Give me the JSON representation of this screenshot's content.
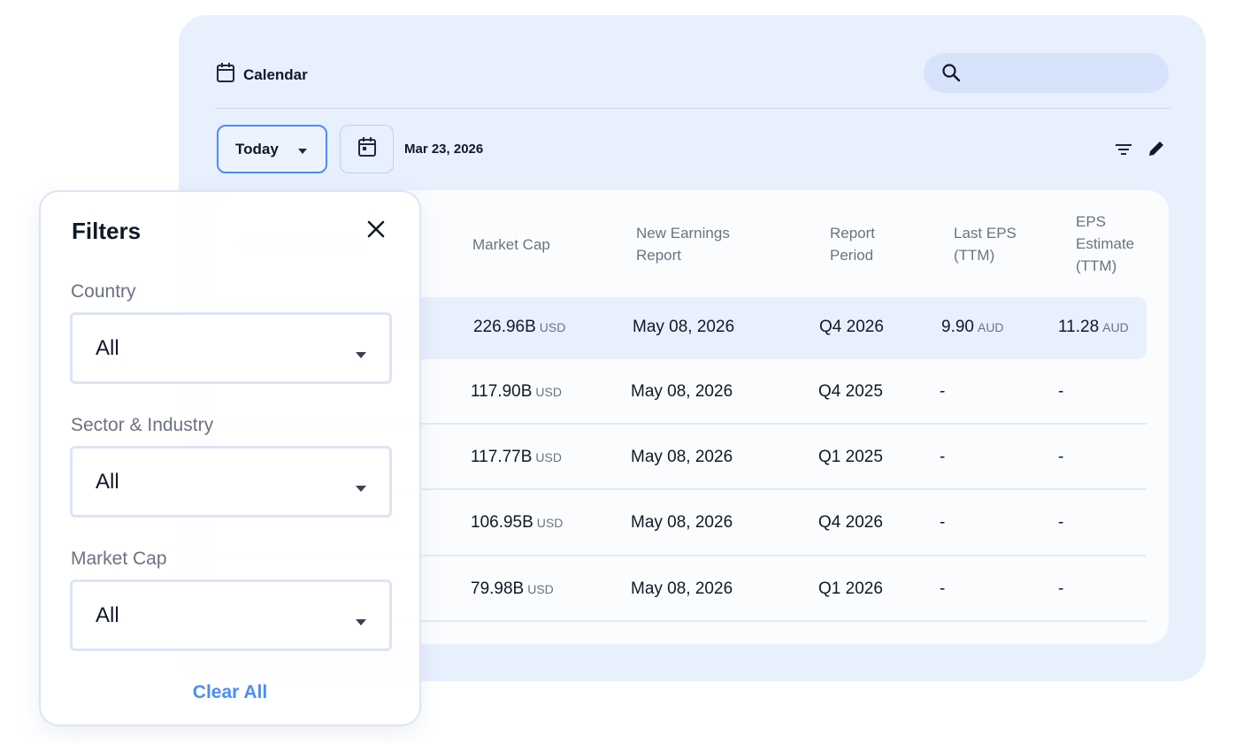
{
  "header": {
    "title": "Calendar",
    "search": {
      "placeholder": ""
    }
  },
  "toolbar": {
    "period_label": "Today",
    "date": "Mar 23, 2026"
  },
  "table": {
    "columns": {
      "market_cap": "Market Cap",
      "new_earnings_report": [
        "New Earnings",
        "Report"
      ],
      "report_period": [
        "Report",
        "Period"
      ],
      "last_eps": [
        "Last EPS",
        "(TTM)"
      ],
      "eps_estimate": [
        "EPS",
        "Estimate",
        "(TTM)"
      ]
    },
    "rows": [
      {
        "market_cap": "226.96B",
        "mc_unit": "USD",
        "report_date": "May 08, 2026",
        "period": "Q4 2026",
        "last_eps": "9.90",
        "last_eps_unit": "AUD",
        "eps_estimate": "11.28",
        "eps_estimate_unit": "AUD"
      },
      {
        "market_cap": "117.90B",
        "mc_unit": "USD",
        "report_date": "May 08, 2026",
        "period": "Q4 2025",
        "last_eps": "-",
        "last_eps_unit": "",
        "eps_estimate": "-",
        "eps_estimate_unit": ""
      },
      {
        "market_cap": "117.77B",
        "mc_unit": "USD",
        "report_date": "May 08, 2026",
        "period": "Q1 2025",
        "last_eps": "-",
        "last_eps_unit": "",
        "eps_estimate": "-",
        "eps_estimate_unit": ""
      },
      {
        "market_cap": "106.95B",
        "mc_unit": "USD",
        "report_date": "May 08, 2026",
        "period": "Q4 2026",
        "last_eps": "-",
        "last_eps_unit": "",
        "eps_estimate": "-",
        "eps_estimate_unit": ""
      },
      {
        "market_cap": "79.98B",
        "mc_unit": "USD",
        "report_date": "May 08, 2026",
        "period": "Q1 2026",
        "last_eps": "-",
        "last_eps_unit": "",
        "eps_estimate": "-",
        "eps_estimate_unit": ""
      }
    ]
  },
  "filters": {
    "title": "Filters",
    "country": {
      "label": "Country",
      "value": "All"
    },
    "sector": {
      "label": "Sector & Industry",
      "value": "All"
    },
    "market_cap": {
      "label": "Market Cap",
      "value": "All"
    },
    "clear_label": "Clear All"
  },
  "colors": {
    "accent": "#4a8ef3",
    "card_bg": "#e8effd",
    "search_bg": "#d7e3fb"
  },
  "icons": [
    "calendar-icon",
    "search-icon",
    "chevron-down-icon",
    "date-picker-icon",
    "filter-icon",
    "edit-icon",
    "close-icon"
  ]
}
